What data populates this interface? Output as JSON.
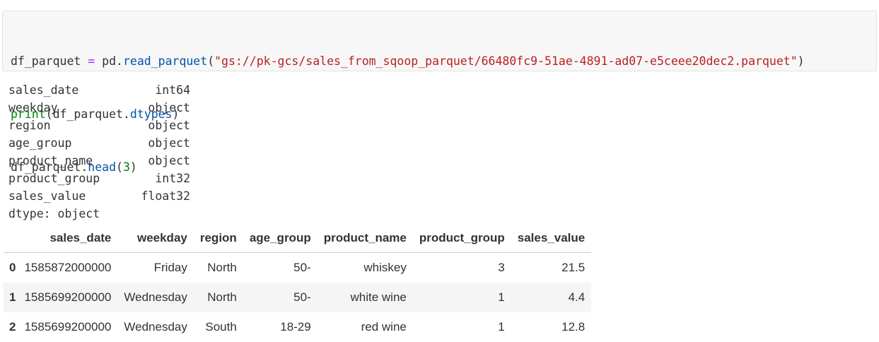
{
  "code": {
    "line1": {
      "var": "df_parquet",
      "eq": " = ",
      "obj": "pd.",
      "fn": "read_parquet",
      "open": "(",
      "str": "\"gs://pk-gcs/sales_from_sqoop_parquet/66480fc9-51ae-4891-ad07-e5ceee20dec2.parquet\"",
      "close": ")"
    },
    "line2": {
      "fn": "print",
      "open": "(",
      "obj": "df_parquet.",
      "attr": "dtypes",
      "close": ")"
    },
    "line3": {
      "obj": "df_parquet.",
      "fn": "head",
      "open": "(",
      "num": "3",
      "close": ")"
    }
  },
  "dtypes": [
    {
      "name": "sales_date",
      "type": "int64"
    },
    {
      "name": "weekday",
      "type": "object"
    },
    {
      "name": "region",
      "type": "object"
    },
    {
      "name": "age_group",
      "type": "object"
    },
    {
      "name": "product_name",
      "type": "object"
    },
    {
      "name": "product_group",
      "type": "int32"
    },
    {
      "name": "sales_value",
      "type": "float32"
    }
  ],
  "dtype_footer": "dtype: object",
  "table": {
    "columns": [
      "",
      "sales_date",
      "weekday",
      "region",
      "age_group",
      "product_name",
      "product_group",
      "sales_value"
    ],
    "rows": [
      [
        "0",
        "1585872000000",
        "Friday",
        "North",
        "50-",
        "whiskey",
        "3",
        "21.5"
      ],
      [
        "1",
        "1585699200000",
        "Wednesday",
        "North",
        "50-",
        "white wine",
        "1",
        "4.4"
      ],
      [
        "2",
        "1585699200000",
        "Wednesday",
        "South",
        "18-29",
        "red wine",
        "1",
        "12.8"
      ]
    ]
  }
}
